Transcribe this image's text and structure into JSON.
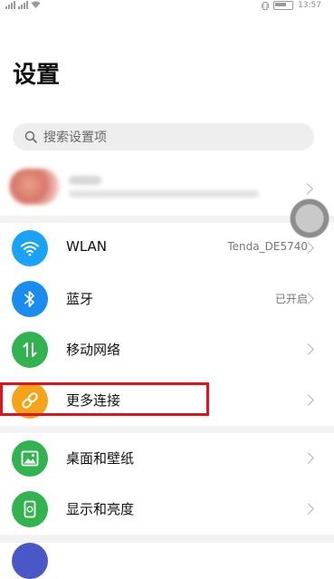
{
  "status_bar": {
    "time": "13:57"
  },
  "page": {
    "title": "设置"
  },
  "search": {
    "placeholder": "搜索设置项"
  },
  "colors": {
    "wlan": "#1aa3f4",
    "bluetooth": "#1a8cf0",
    "mobile": "#33b350",
    "more": "#f5a419",
    "wallpaper": "#33b350",
    "display": "#33b350",
    "highlight": "#e0141c"
  },
  "settings": [
    {
      "icon": "wifi-icon",
      "label": "WLAN",
      "value": "Tenda_DE5740"
    },
    {
      "icon": "bluetooth-icon",
      "label": "蓝牙",
      "value": "已开启"
    },
    {
      "icon": "mobile-network-icon",
      "label": "移动网络",
      "value": ""
    },
    {
      "icon": "link-icon",
      "label": "更多连接",
      "value": ""
    },
    {
      "icon": "image-icon",
      "label": "桌面和壁纸",
      "value": ""
    },
    {
      "icon": "phone-display-icon",
      "label": "显示和亮度",
      "value": ""
    }
  ]
}
